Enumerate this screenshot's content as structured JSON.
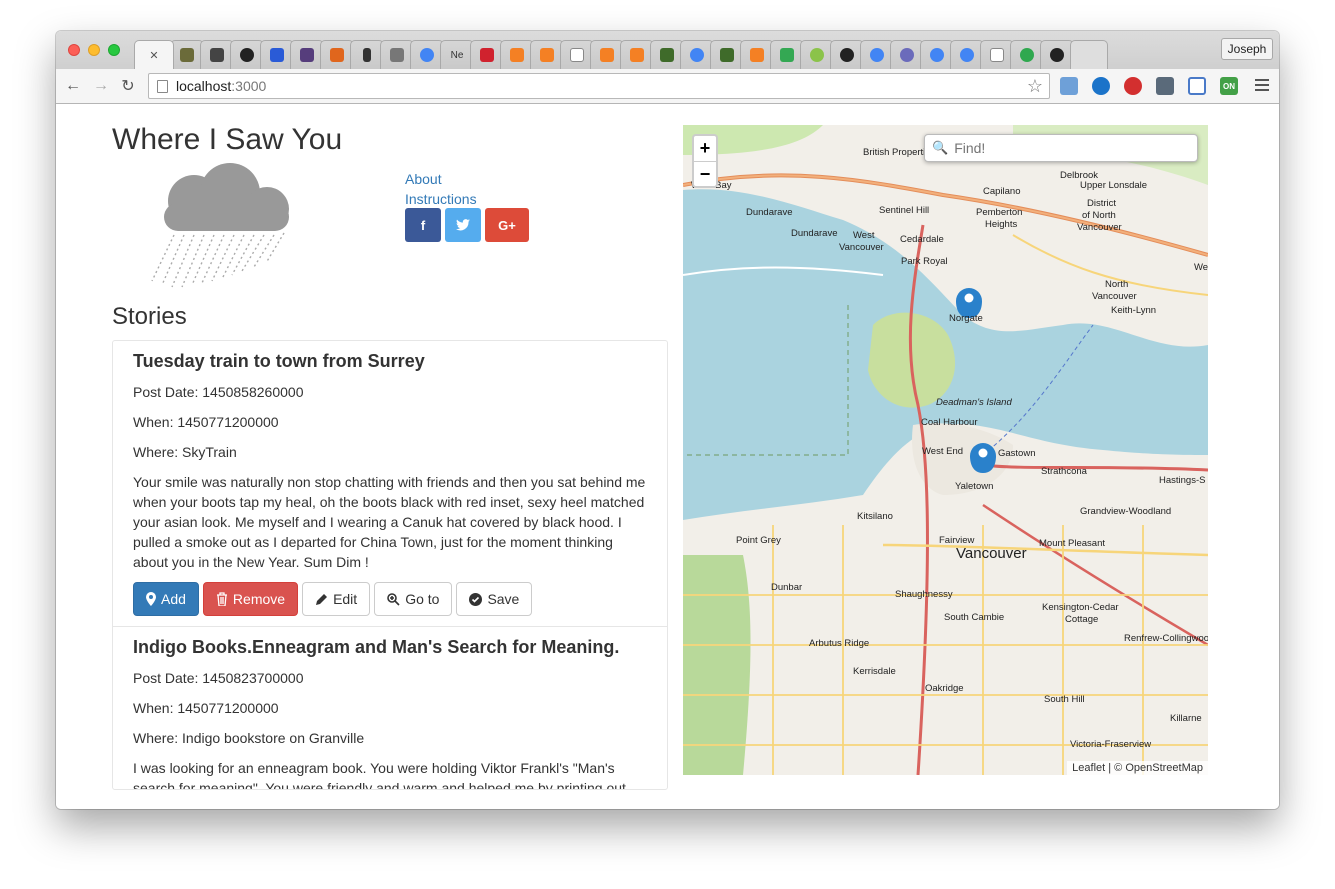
{
  "browser": {
    "active_tab_close": "✕",
    "tab_text_label": "Ne",
    "profile_name": "Joseph",
    "url_host": "localhost",
    "url_port": ":3000",
    "ext_on_label": "ON"
  },
  "header": {
    "title": "Where I Saw You",
    "links": [
      "About",
      "Instructions"
    ],
    "social": {
      "facebook": "f",
      "twitter": "t",
      "googleplus": "G+"
    }
  },
  "stories": {
    "title": "Stories",
    "items": [
      {
        "title": "Tuesday train to town from Surrey",
        "post_date": "Post Date: 1450858260000",
        "when": "When: 1450771200000",
        "where": "Where: SkyTrain",
        "body": "Your smile was naturally non stop chatting with friends and then you sat behind me when your boots tap my heal, oh the boots black with red inset, sexy heel matched your asian look. Me myself and I wearing a Canuk hat covered by black hood. I pulled a smoke out as I departed for China Town, just for the moment thinking about you in the New Year. Sum Dim !"
      },
      {
        "title": "Indigo Books.Enneagram and Man's Search for Meaning.",
        "post_date": "Post Date: 1450823700000",
        "when": "When: 1450771200000",
        "where": "Where: Indigo bookstore on Granville",
        "body": "I was looking for an enneagram book. You were holding Viktor Frankl's \"Man's search for meaning\". You were friendly and warm and helped me by printing out"
      }
    ],
    "buttons": {
      "add": "Add",
      "remove": "Remove",
      "edit": "Edit",
      "goto": "Go to",
      "save": "Save"
    }
  },
  "map": {
    "zoom_in": "+",
    "zoom_out": "−",
    "search_placeholder": "Find!",
    "attribution": "Leaflet | © OpenStreetMap",
    "labels": {
      "british_properties": "British Properties",
      "west_bay": "West Bay",
      "capilano": "Capilano",
      "delbrook": "Delbrook",
      "upper_lonsdale": "Upper Lonsdale",
      "district": "District",
      "of_north": "of North",
      "vancouver_nv": "Vancouver",
      "dundarave": "Dundarave",
      "sentinel_hill": "Sentinel Hill",
      "pemberton": "Pemberton",
      "heights": "Heights",
      "dundarave2": "Dundarave",
      "west": "West",
      "vancouver_w": "Vancouver",
      "cedardale": "Cedardale",
      "park_royal": "Park Royal",
      "north": "North",
      "vancouver_n": "Vancouver",
      "keith_lynn": "Keith-Lynn",
      "norgate": "Norgate",
      "deadmans_island": "Deadman's Island",
      "coal_harbour": "Coal Harbour",
      "west_end": "West End",
      "gastown": "Gastown",
      "strathcona": "Strathcona",
      "hastings": "Hastings-S",
      "yaletown": "Yaletown",
      "kitsilano": "Kitsilano",
      "grandview": "Grandview-Woodland",
      "point_grey": "Point Grey",
      "fairview": "Fairview",
      "vancouver_big": "Vancouver",
      "mount_pleasant": "Mount Pleasant",
      "dunbar": "Dunbar",
      "shaughnessy": "Shaughnessy",
      "kensington": "Kensington-Cedar",
      "cottage": "Cottage",
      "south_cambie": "South Cambie",
      "renfrew": "Renfrew-Collingwood",
      "arbutus": "Arbutus Ridge",
      "kerrisdale": "Kerrisdale",
      "oakridge": "Oakridge",
      "south_hill": "South Hill",
      "killarney": "Killarne",
      "victoria": "Victoria-Fraserview",
      "we": "We"
    }
  },
  "colors": {
    "primary": "#337ab7",
    "danger": "#d9534f",
    "water": "#aad3df",
    "land": "#f2efe9",
    "facebook": "#3b5998",
    "twitter": "#55acee",
    "googleplus": "#dd4b39"
  }
}
